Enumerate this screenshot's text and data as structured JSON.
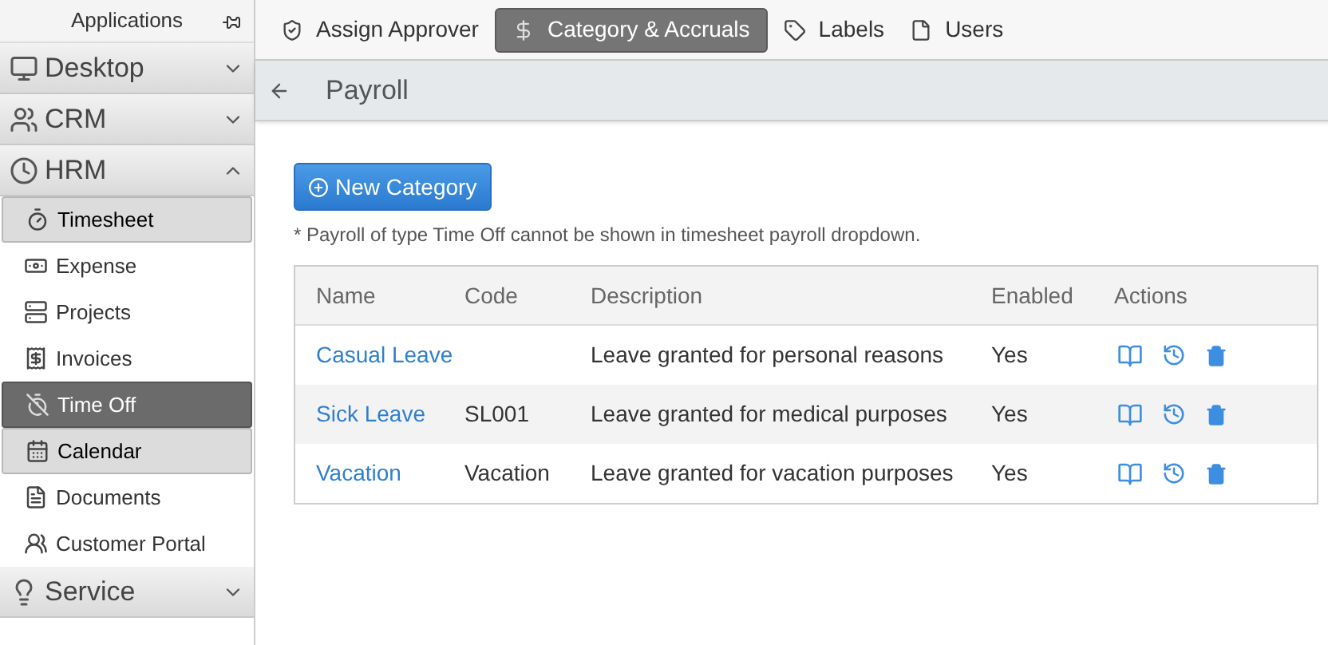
{
  "sidebar": {
    "title": "Applications",
    "groups": [
      {
        "label": "Desktop",
        "expanded": false
      },
      {
        "label": "CRM",
        "expanded": false
      },
      {
        "label": "HRM",
        "expanded": true,
        "items": [
          {
            "label": "Timesheet",
            "selected": false,
            "highlighted": true
          },
          {
            "label": "Expense",
            "selected": false,
            "highlighted": false
          },
          {
            "label": "Projects",
            "selected": false,
            "highlighted": false
          },
          {
            "label": "Invoices",
            "selected": false,
            "highlighted": false
          },
          {
            "label": "Time Off",
            "selected": true,
            "highlighted": false
          },
          {
            "label": "Calendar",
            "selected": false,
            "highlighted": true
          },
          {
            "label": "Documents",
            "selected": false,
            "highlighted": false
          },
          {
            "label": "Customer Portal",
            "selected": false,
            "highlighted": false
          }
        ]
      },
      {
        "label": "Service",
        "expanded": false
      }
    ]
  },
  "tabs": [
    {
      "label": "Assign Approver",
      "selected": false
    },
    {
      "label": "Category & Accruals",
      "selected": true
    },
    {
      "label": "Labels",
      "selected": false
    },
    {
      "label": "Users",
      "selected": false
    }
  ],
  "page_title": "Payroll",
  "new_button": "New Category",
  "note": "* Payroll of type Time Off cannot be shown in timesheet payroll dropdown.",
  "table": {
    "columns": [
      "Name",
      "Code",
      "Description",
      "Enabled",
      "Actions"
    ],
    "rows": [
      {
        "name": "Casual Leave",
        "code": "",
        "description": "Leave granted for personal reasons",
        "enabled": "Yes"
      },
      {
        "name": "Sick Leave",
        "code": "SL001",
        "description": "Leave granted for medical purposes",
        "enabled": "Yes"
      },
      {
        "name": "Vacation",
        "code": "Vacation",
        "description": "Leave granted for vacation purposes",
        "enabled": "Yes"
      }
    ]
  }
}
